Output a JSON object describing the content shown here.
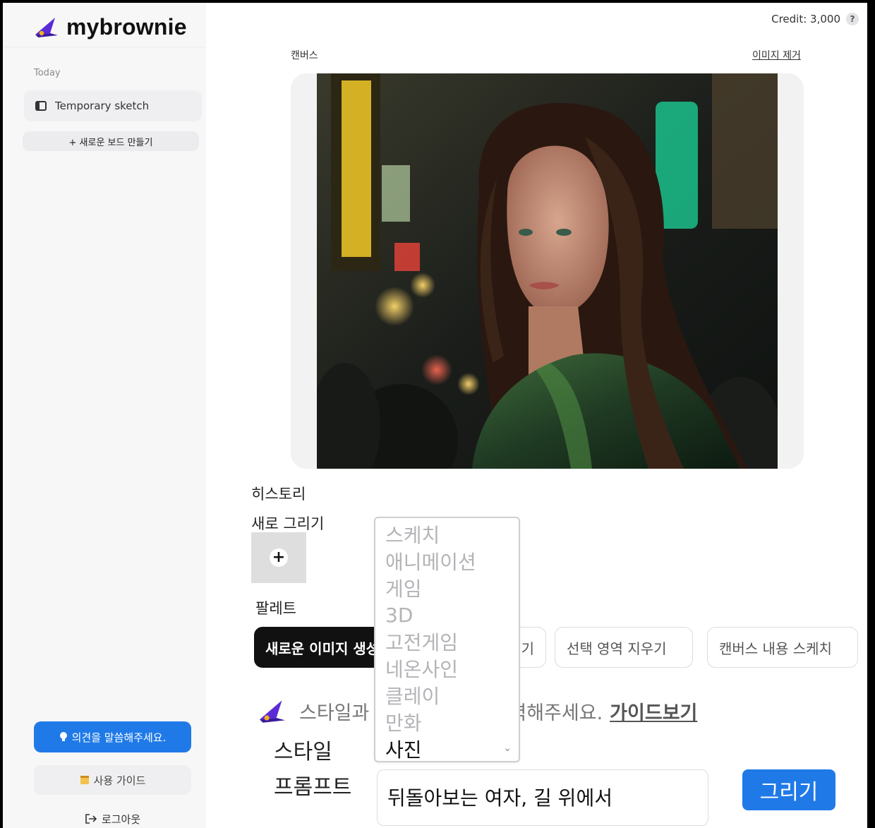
{
  "sidebar": {
    "brand": "mybrownie",
    "section_today": "Today",
    "board_item": "Temporary sketch",
    "new_board": "+ 새로운 보드 만들기",
    "feedback": "의견을 말씀해주세요.",
    "guide": "사용 가이드",
    "logout": "로그아웃"
  },
  "topbar": {
    "credit": "Credit: 3,000",
    "help": "?"
  },
  "canvas": {
    "label": "캔버스",
    "remove": "이미지 제거"
  },
  "history": {
    "label": "히스토리",
    "new_draw": "새로 그리기"
  },
  "palette": {
    "label": "팔레트",
    "buttons": [
      "새로운 이미지 생성",
      "기",
      "선택 영역 지우기",
      "캔버스 내용 스케치"
    ]
  },
  "hint": {
    "text_prefix": "스타일과",
    "text_suffix": "력해주세요.",
    "guide_link": "가이드보기"
  },
  "form": {
    "style_label": "스타일",
    "prompt_label": "프롬프트",
    "prompt_value": "뒤돌아보는 여자, 길 위에서",
    "submit": "그리기"
  },
  "style_select": {
    "options": [
      "스케치",
      "애니메이션",
      "게임",
      "3D",
      "고전게임",
      "네온사인",
      "클레이",
      "만화",
      "사진"
    ],
    "selected": "사진"
  },
  "colors": {
    "accent": "#1f7ae8",
    "dark_button": "#111111",
    "sidebar_bg": "#f7f7f8"
  }
}
